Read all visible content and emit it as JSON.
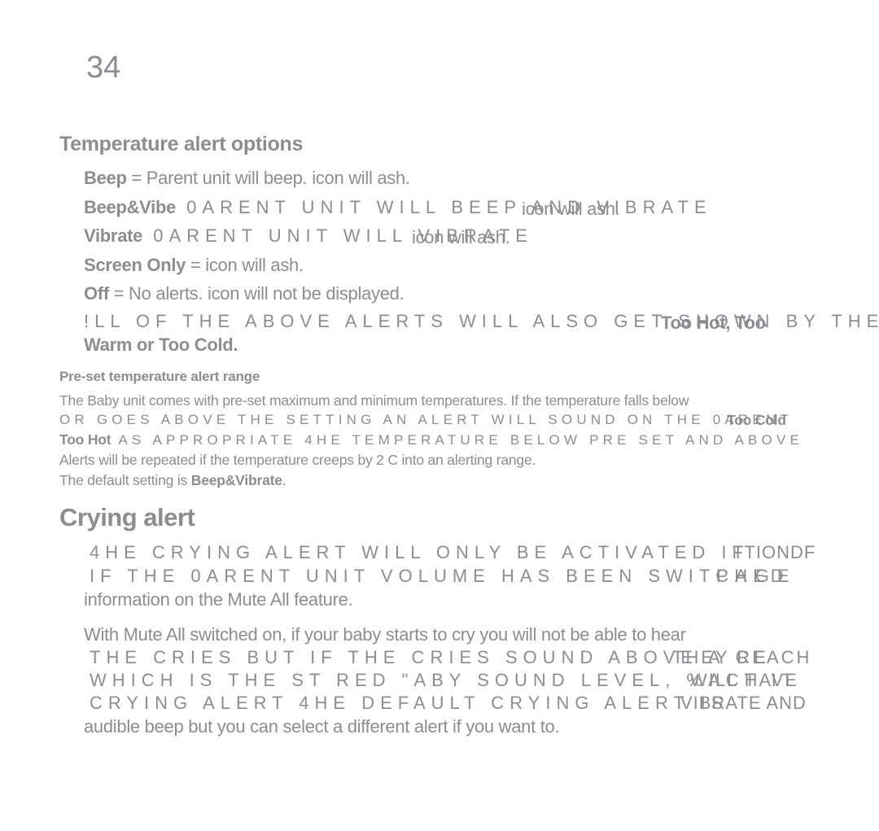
{
  "page_number": "34",
  "temperature_alert_options": {
    "heading": "Temperature alert options",
    "options": [
      {
        "term": "Beep",
        "rest": " = Parent unit will beep.     icon will  ash."
      },
      {
        "term": "Beep&Vibe",
        "rest": "   0ARENT UNIT WILL BEEP AND VIBRATE",
        "overlay": "icon will  ash."
      },
      {
        "term": "Vibrate",
        "rest": "   0ARENT UNIT WILL VIBRATE",
        "overlay": "icon will  ash."
      },
      {
        "term": "Screen Only",
        "rest": " =     icon will  ash."
      },
      {
        "term": "Off",
        "rest": " = No alerts.     icon will not be displayed."
      }
    ],
    "note_line1": "!LL OF THE ABOVE ALERTS WILL ALSO GET SHOWN BY THE",
    "note_overlay": "Too Hot, Too",
    "note_line2": "Warm or Too Cold."
  },
  "preset_range": {
    "heading": "Pre-set temperature alert range",
    "line1": "The Baby unit comes with pre-set maximum and minimum temperatures. If the temperature falls below",
    "line2": " OR GOES ABOVE THE SETTING AN ALERT WILL SOUND ON THE 0ARENT",
    "line2_overlay": "Too Cold",
    "line3_term": "Too Hot",
    "line3_rest": "  AS APPROPRIATE  4HE TEMPERATURE BELOW PRE SET AND ABOVE",
    "line4": "Alerts will be repeated if the temperature creeps by 2 C into an alerting range.",
    "line5_prefix": "The default setting is ",
    "line5_term": "Beep&Vibrate",
    "line5_suffix": "."
  },
  "crying_alert": {
    "heading": "Crying alert",
    "para1_line1": "4HE CRYING ALERT WILL ONLY BE ACTIVATED IF",
    "para1_line1_overlay": "TTIONDF",
    "para1_line2": "IF THE 0ARENT UNIT VOLUME HAS BEEN SWITCHED",
    "para1_line2_overlay": "PAGE",
    "para1_line3": "information on the Mute All feature.",
    "para2_line1": "With Mute All switched on, if your baby starts to cry you will not be able to hear",
    "para2_line2": "THE CRIES  BUT IF THE CRIES SOUND ABOVE A CE",
    "para2_line2_overlay": "THEY REACH",
    "para2_line3": "WHICH IS THE  ST RED \"ABY SOUND LEVEL, %ACT IT",
    "para2_line3_overlay": "WILL HAVE",
    "para2_line4": "CRYING ALERT  4HE DEFAULT CRYING ALERT IS",
    "para2_line4_overlay": "VIBRATE AND",
    "para2_line5": "audible beep but you can select a different alert if you want to."
  }
}
